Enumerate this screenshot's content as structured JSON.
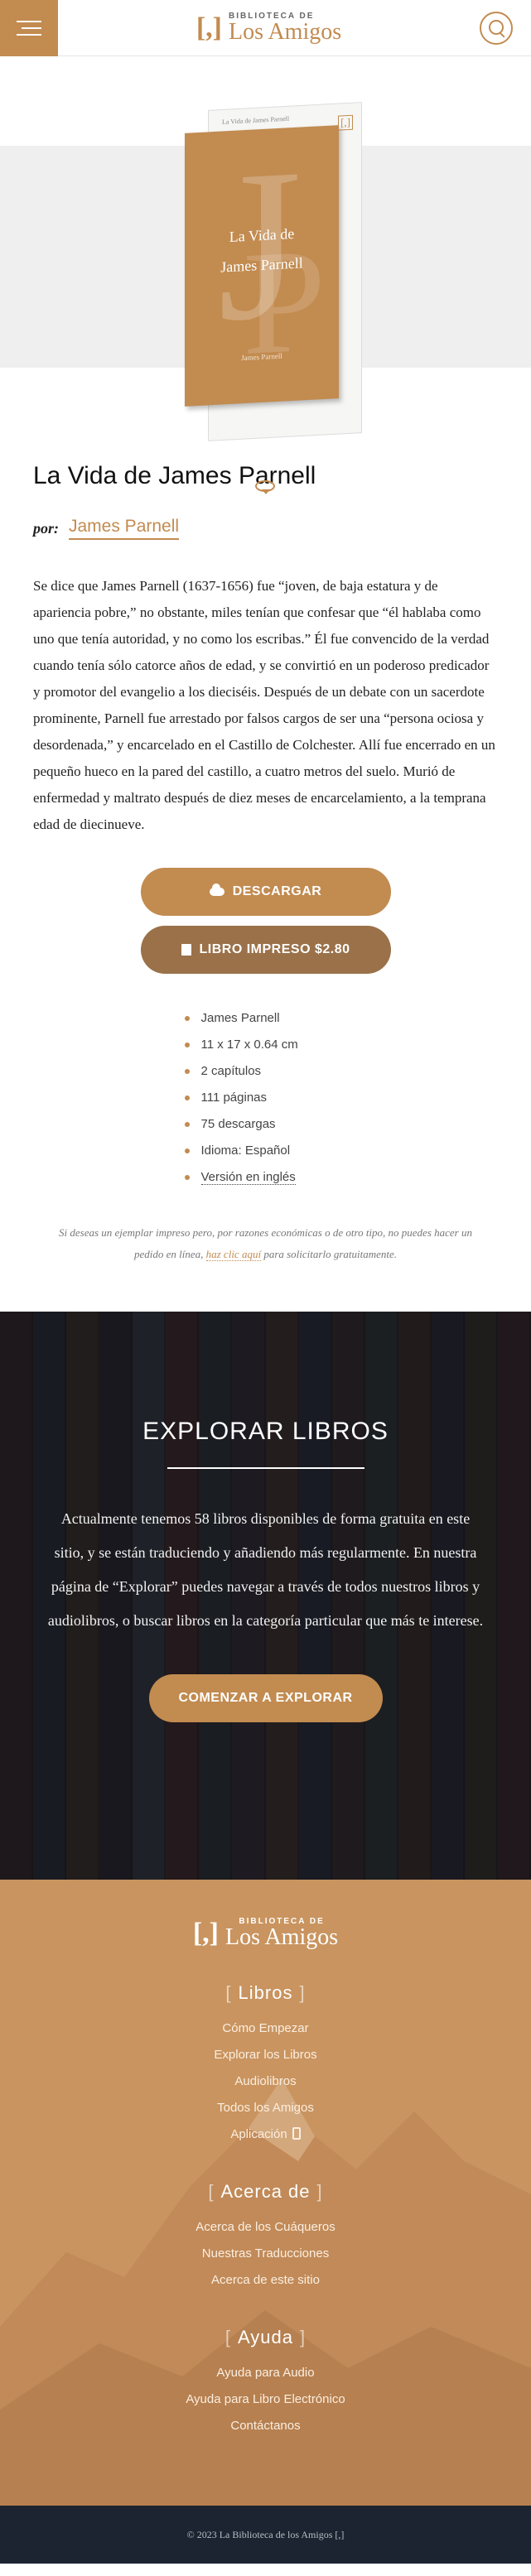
{
  "header": {
    "logo_mark": "[,]",
    "logo_small": "BIBLIOTECA DE",
    "logo_big": "Los Amigos"
  },
  "cover": {
    "page_title": "La Vida de James Parnell",
    "page_mark": "[,]",
    "big_letter_1": "J",
    "big_letter_2": "P",
    "title_line1": "La Vida de",
    "title_line2": "James Parnell",
    "author": "James Parnell"
  },
  "book": {
    "title": "La Vida de James Parnell",
    "by_label": "por:",
    "author": "James Parnell",
    "blurb": "Se dice que James Parnell (1637-1656) fue “joven, de baja estatura y de apariencia pobre,” no obstante, miles tenían que confesar que “él hablaba como uno que tenía autoridad, y no como los escribas.” Él fue convencido de la verdad cuando tenía sólo catorce años de edad, y se convirtió en un poderoso predicador y promotor del evangelio a los dieciséis. Después de un debate con un sacerdote prominente, Parnell fue arrestado por falsos cargos de ser una “persona ociosa y desordenada,” y encarcelado en el Castillo de Colchester. Allí fue encerrado en un pequeño hueco en la pared del castillo, a cuatro metros del suelo. Murió de enfermedad y maltrato después de diez meses de encarcelamiento, a la temprana edad de diecinueve."
  },
  "buttons": {
    "download": "DESCARGAR",
    "print": "LIBRO IMPRESO $2.80"
  },
  "details": [
    "James Parnell",
    "11 x 17 x 0.64 cm",
    "2 capítulos",
    "111 páginas",
    "75 descargas",
    "Idioma: Español",
    "Versión en inglés"
  ],
  "note": {
    "before": "Si deseas un ejemplar impreso pero, por razones económicas o de otro tipo, no puedes hacer un pedido en línea,",
    "link": "haz clic aquí",
    "after": "para solicitarlo gratuitamente."
  },
  "explore": {
    "title": "EXPLORAR LIBROS",
    "text": "Actualmente tenemos 58 libros disponibles de forma gratuita en este sitio, y se están traduciendo y añadiendo más regularmente. En nuestra página de “Explorar” puedes navegar a través de todos nuestros libros y audiolibros, o buscar libros en la categoría particular que más te interese.",
    "button": "COMENZAR A EXPLORAR",
    "spine_colors": [
      "#3a2a2c",
      "#2a3440",
      "#4a3a30",
      "#2e2a36",
      "#3c4a52",
      "#512c2e",
      "#2c3a3e",
      "#3a3040",
      "#4d3f2f",
      "#263444",
      "#3f2f35",
      "#2f4040",
      "#44322a",
      "#2a2e40",
      "#3a3a2a",
      "#402a30"
    ]
  },
  "footer": {
    "sections": [
      {
        "heading": "Libros",
        "items": [
          "Cómo Empezar",
          "Explorar los Libros",
          "Audiolibros",
          "Todos los Amigos",
          "Aplicación"
        ]
      },
      {
        "heading": "Acerca de",
        "items": [
          "Acerca de los Cuáqueros",
          "Nuestras Traducciones",
          "Acerca de este sitio"
        ]
      },
      {
        "heading": "Ayuda",
        "items": [
          "Ayuda para Audio",
          "Ayuda para Libro Electrónico",
          "Contáctanos"
        ]
      }
    ],
    "copyright": "© 2023 La Biblioteca de los Amigos [,]"
  },
  "colors": {
    "accent": "#c28b50",
    "accent_dark": "#9a7149",
    "footer_bg": "#c9945f",
    "bottom_bar": "#1b2430"
  },
  "icons": {
    "menu": "hamburger-icon",
    "search": "search-icon",
    "rotate": "rotate-icon",
    "download": "cloud-icon",
    "print": "book-icon",
    "app": "phone-icon"
  }
}
